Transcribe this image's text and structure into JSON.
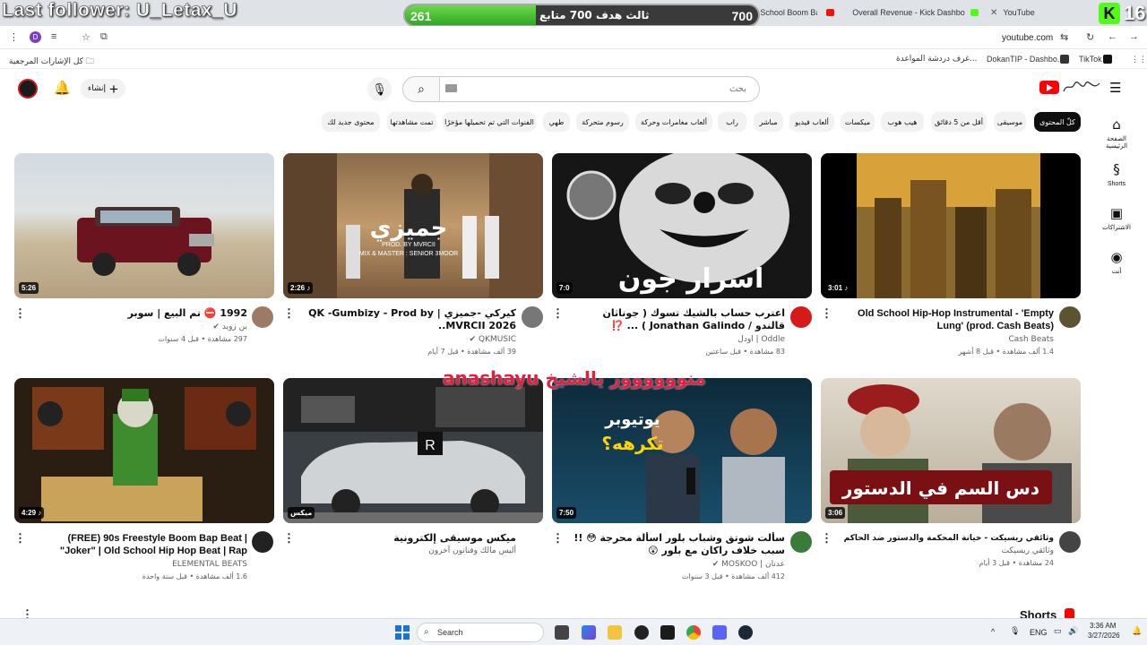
{
  "overlay": {
    "follower_text": "Last follower: U_Letax_U",
    "goal_left": "261",
    "goal_label": "ثالث هدف 700 متابع",
    "goal_right": "700",
    "goal_progress": 0.37,
    "kick_count": "16",
    "stream_text": "anashayu منوووووور يالشيخ"
  },
  "browser": {
    "tabs": [
      {
        "label": "(FREE) 90s Old School Boom Ba"
      },
      {
        "label": "Overall Revenue - Kick Dashbo"
      },
      {
        "label": "YouTube"
      }
    ],
    "profile_initial": "D",
    "url": "youtube.com",
    "bookmarks": [
      {
        "label": "كل الإشارات المرجعية"
      },
      {
        "label": "غرف دردشة المواعدة..."
      },
      {
        "label": "DokanTIP - Dashbo..."
      },
      {
        "label": "TikTok"
      }
    ]
  },
  "youtube": {
    "create_label": "إنشاء",
    "search_placeholder": "بحث",
    "chips": [
      {
        "label": "كلّ المحتوى",
        "active": true
      },
      {
        "label": "موسيقى"
      },
      {
        "label": "أقل من 5 دقائق"
      },
      {
        "label": "هيب هوب"
      },
      {
        "label": "ميكسات"
      },
      {
        "label": "ألعاب فيديو"
      },
      {
        "label": "مباشر"
      },
      {
        "label": "راب"
      },
      {
        "label": "ألعاب مغامرات وحركة"
      },
      {
        "label": "رسوم متحركة"
      },
      {
        "label": "طهي"
      },
      {
        "label": "الفنوات التي تم تحميلها مؤخرًا"
      },
      {
        "label": "تمت مشاهدتها"
      },
      {
        "label": "محتوى جديد لك"
      }
    ],
    "nav": [
      {
        "label": "الصفحة الرئيسية",
        "icon": "home-icon"
      },
      {
        "label": "Shorts",
        "icon": "shorts-icon"
      },
      {
        "label": "الاشتراكات",
        "icon": "subscriptions-icon"
      },
      {
        "label": "أنت",
        "icon": "you-icon"
      }
    ],
    "videos": [
      {
        "title": "1992 ⛔ تم البيع | سوبر",
        "channel": "بن زويد ✔",
        "meta": "297 مشاهدة • قبل 4 سنوات",
        "duration": "5:26"
      },
      {
        "title": "كيركي -جميزي | QK -Gumbizy - Prod by .MVRCII 2026.",
        "channel": "QKMUSIC ✔",
        "meta": "39 ألف مشاهدة • قبل 7 أيام",
        "duration": "2:26 ♪"
      },
      {
        "title": "اعترب حساب بالشيك تسوك ( جوناثان قالندو / Jonathan Galindo ) ... ⁉️",
        "channel": "Oddle | اودل",
        "meta": "83 مشاهدة • قبل ساعتين",
        "duration": "7:0"
      },
      {
        "title": "Old School Hip-Hop Instrumental - 'Empty Lung' (prod. Cash Beats)",
        "channel": "Cash Beats",
        "meta": "1.4 ألف مشاهدة • قبل 8 أشهر",
        "duration": "3:01 ♪"
      },
      {
        "title": "(FREE) 90s Freestyle Boom Bap Beat | \"Joker\" | Old School Hip Hop Beat | Rap Instrumental",
        "channel": "ELEMENTAL BEATS",
        "meta": "1.6 ألف مشاهدة • قبل سنة واحدة",
        "duration": "4:29 ♪"
      },
      {
        "title": "ميكس موسيقى إلكترونية",
        "channel": "أليس مالك وفنانون آخرون",
        "meta": "",
        "duration": "ميكس"
      },
      {
        "title": "سألت شوتق وشباب بلور اسألة محرجة 😳 !! سبب خلاف راكان مع بلور 😲",
        "channel": "عدنان | MOSKOO ✔",
        "meta": "412 ألف مشاهدة • قبل 3 سنوات",
        "duration": "7:50"
      },
      {
        "title": "وثائقي ريسيكت - خيانة المحكمة والدستور ضد الحاكم كافح المكافح",
        "channel": "وثائقي ريسيكت",
        "meta": "24 مشاهدة • قبل 3 أيام",
        "duration": "3:06"
      }
    ],
    "shorts_label": "Shorts"
  },
  "taskbar": {
    "search_label": "Search",
    "lang": "ENG",
    "time": "3:36 AM",
    "date": "3/27/2026"
  }
}
